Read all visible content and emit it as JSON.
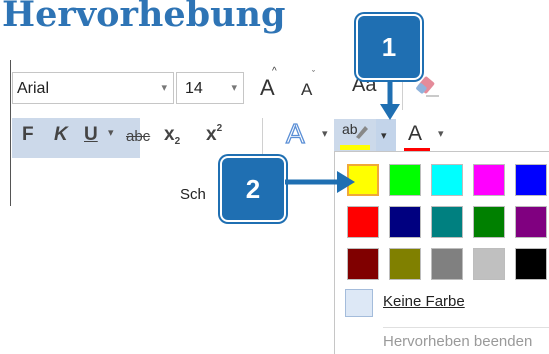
{
  "heading": "Hervorhebung",
  "font": {
    "name": "Arial",
    "size": "14",
    "grow_icon": "A",
    "shrink_icon": "A",
    "case_label": "Aa",
    "clear_icon": "eraser-icon"
  },
  "format": {
    "bold": "F",
    "italic": "K",
    "underline": "U",
    "strike": "abc",
    "subscript": "x",
    "sub_mark": "2",
    "superscript": "x",
    "sup_mark": "2",
    "effects": "A",
    "highlight_label": "ab",
    "font_color_label": "A"
  },
  "group_label": "Sch",
  "palette": {
    "rows": [
      [
        "#ffff00",
        "#00ff00",
        "#00ffff",
        "#ff00ff",
        "#0000ff"
      ],
      [
        "#ff0000",
        "#000080",
        "#008080",
        "#008000",
        "#800080"
      ],
      [
        "#800000",
        "#808000",
        "#808080",
        "#c0c0c0",
        "#000000"
      ]
    ],
    "no_color": "Keine Farbe",
    "stop_highlight": "Hervorheben beenden"
  },
  "callouts": {
    "one": "1",
    "two": "2"
  },
  "colors": {
    "heading": "#2e74b5",
    "badge": "#1f6fb2",
    "highlight_bar": "#ffff00",
    "font_color_bar": "#ff0000"
  }
}
